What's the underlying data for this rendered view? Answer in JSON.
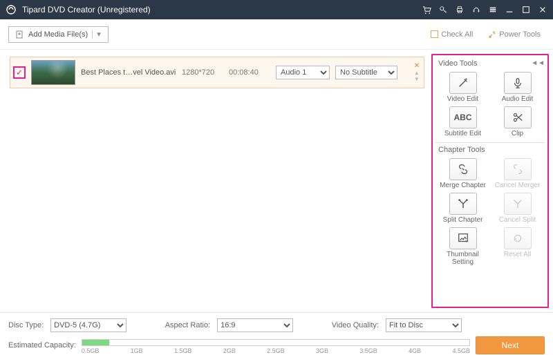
{
  "title": "Tipard DVD Creator (Unregistered)",
  "toolbar": {
    "add_label": "Add Media File(s)",
    "check_all": "Check All",
    "power_tools": "Power Tools"
  },
  "media": {
    "filename": "Best Places t…vel Video.avi",
    "resolution": "1280*720",
    "duration": "00:08:40",
    "audio_selected": "Audio 1",
    "subtitle_selected": "No Subtitle"
  },
  "side": {
    "video_tools_title": "Video Tools",
    "video_edit": "Video Edit",
    "audio_edit": "Audio Edit",
    "subtitle_edit": "Subtitle Edit",
    "clip": "Clip",
    "chapter_tools_title": "Chapter Tools",
    "merge_chapter": "Merge Chapter",
    "cancel_merger": "Cancel Merger",
    "split_chapter": "Split Chapter",
    "cancel_split": "Cancel Split",
    "thumbnail_setting": "Thumbnail Setting",
    "reset_all": "Reset All"
  },
  "bottom": {
    "disc_type_label": "Disc Type:",
    "disc_type_value": "DVD-5 (4.7G)",
    "aspect_label": "Aspect Ratio:",
    "aspect_value": "16:9",
    "quality_label": "Video Quality:",
    "quality_value": "Fit to Disc",
    "capacity_label": "Estimated Capacity:",
    "ticks": [
      "0.5GB",
      "1GB",
      "1.5GB",
      "2GB",
      "2.5GB",
      "3GB",
      "3.5GB",
      "4GB",
      "4.5GB"
    ],
    "fill_percent": 7,
    "next": "Next"
  }
}
